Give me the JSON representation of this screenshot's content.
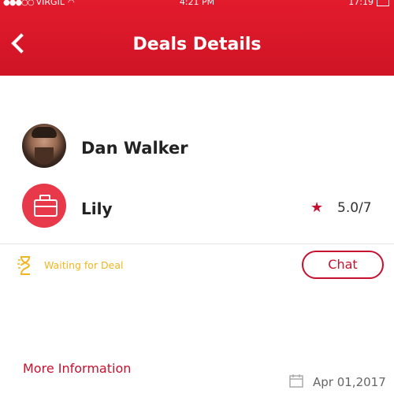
{
  "status_bar": {
    "signal": "●●●○○",
    "carrier": "VIRGIL",
    "time": "4:21 PM",
    "battery": "17:19"
  },
  "header": {
    "title": "Deals Details"
  },
  "contact": {
    "name": "Dan Walker"
  },
  "company": {
    "name": "Lily",
    "rating": "5.0/7"
  },
  "deal": {
    "status": "Waiting for Deal",
    "chat_label": "Chat"
  },
  "more_info": {
    "label": "More Information",
    "date": "Apr 01,2017"
  },
  "colors": {
    "brand_red": "#c8102e",
    "status_yellow": "#f1b61f"
  },
  "icons": [
    "back-icon",
    "avatar",
    "briefcase-icon",
    "star-icon",
    "hourglass-icon",
    "calendar-icon",
    "wifi-icon",
    "battery-icon"
  ]
}
